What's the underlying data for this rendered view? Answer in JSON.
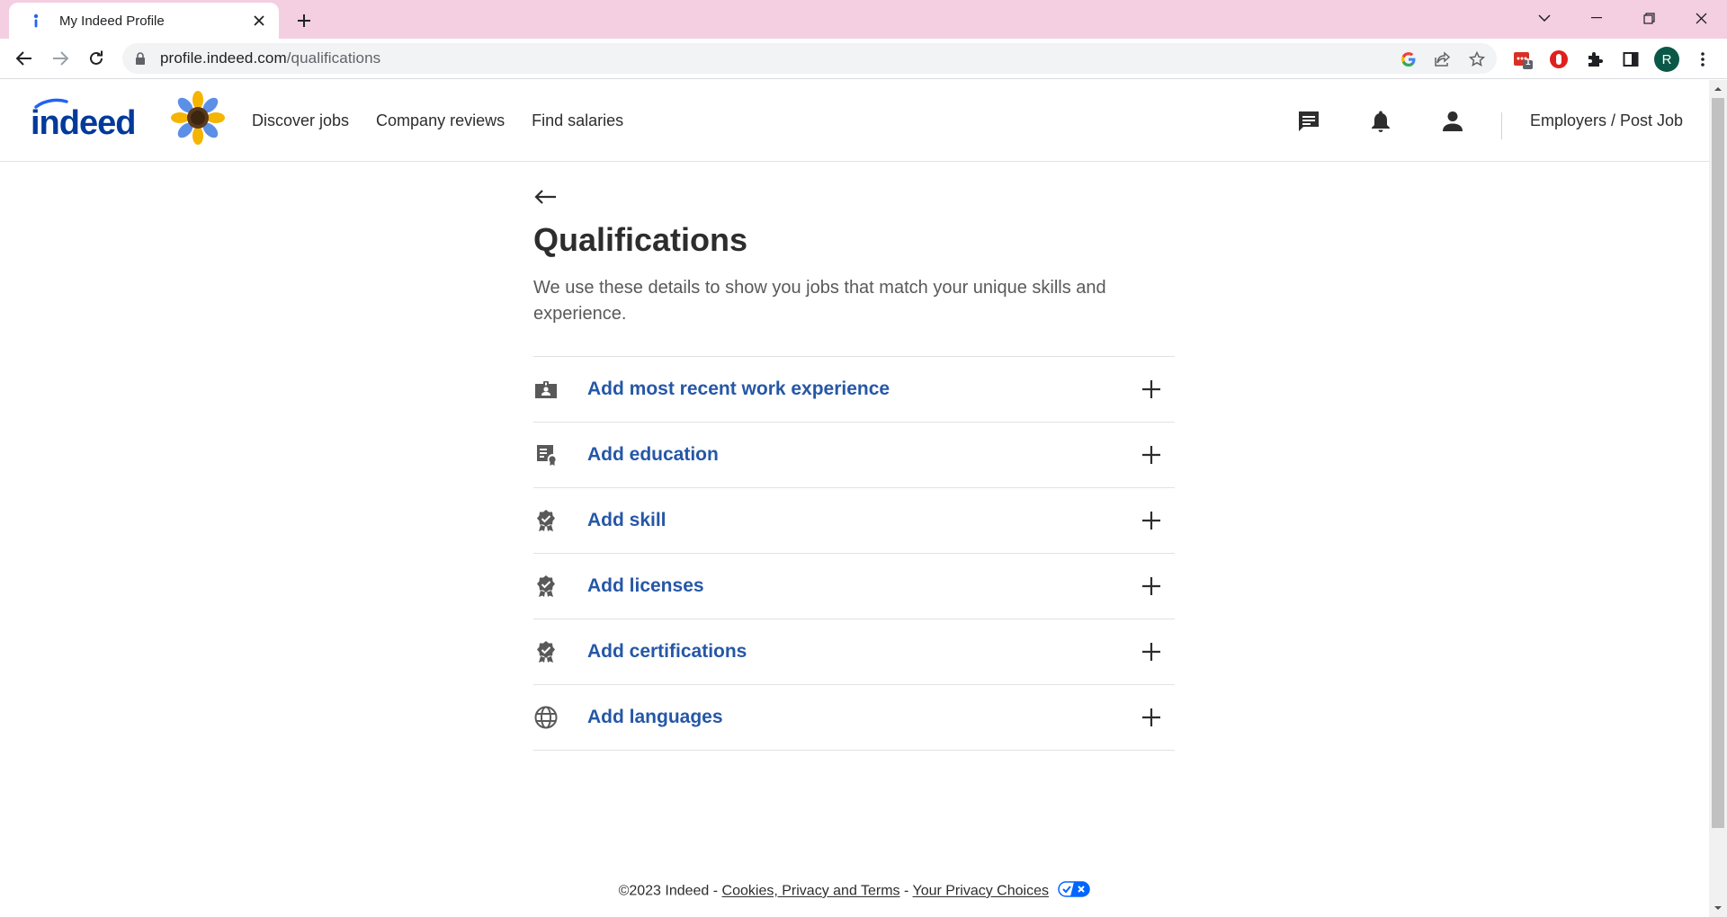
{
  "browser": {
    "tab_title": "My Indeed Profile",
    "url_host": "profile.indeed.com",
    "url_path": "/qualifications",
    "profile_initial": "R",
    "extension_badge": "1"
  },
  "header": {
    "logo_text": "indeed",
    "nav": [
      "Discover jobs",
      "Company reviews",
      "Find salaries"
    ],
    "employers_link": "Employers / Post Job"
  },
  "main": {
    "title": "Qualifications",
    "subtitle": "We use these details to show you jobs that match your unique skills and experience.",
    "items": [
      {
        "label": "Add most recent work experience",
        "icon": "work-icon"
      },
      {
        "label": "Add education",
        "icon": "education-icon"
      },
      {
        "label": "Add skill",
        "icon": "award-icon"
      },
      {
        "label": "Add licenses",
        "icon": "award-icon"
      },
      {
        "label": "Add certifications",
        "icon": "award-icon"
      },
      {
        "label": "Add languages",
        "icon": "globe-icon"
      }
    ]
  },
  "footer": {
    "copyright": "©2023 Indeed",
    "sep1": " - ",
    "link1": "Cookies, Privacy and Terms",
    "sep2": " - ",
    "link2": "Your Privacy Choices"
  },
  "colors": {
    "tabstrip": "#f4cfe1",
    "link_blue": "#2557a7",
    "logo_blue": "#2164f3",
    "text": "#2d2d2d"
  }
}
